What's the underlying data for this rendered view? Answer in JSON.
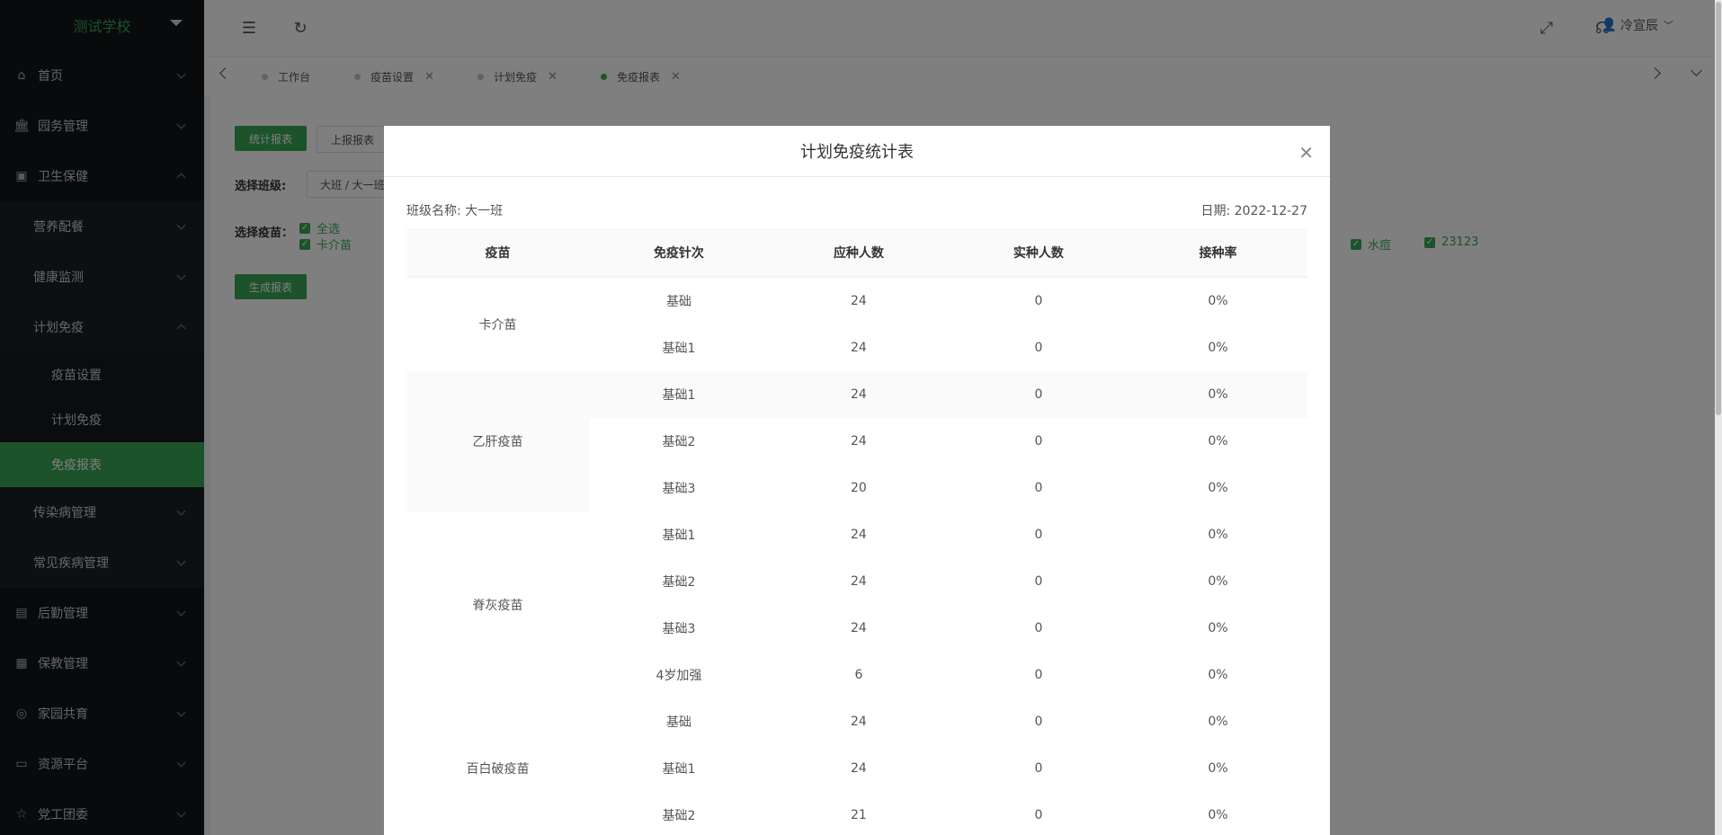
{
  "sidebar": {
    "school": "测试学校",
    "menu": {
      "home": "首页",
      "affairs": "园务管理",
      "health": "卫生保健",
      "nutrition": "营养配餐",
      "monitor": "健康监测",
      "immunization": "计划免疫",
      "vaccine_settings": "疫苗设置",
      "plan_immunization": "计划免疫",
      "immunization_report": "免疫报表",
      "infectious": "传染病管理",
      "common_disease": "常见疾病管理",
      "logistics": "后勤管理",
      "care": "保教管理",
      "home_school": "家园共育",
      "resources": "资源平台",
      "party": "党工团委"
    }
  },
  "topbar": {
    "user": "冷宣辰"
  },
  "tabs": [
    {
      "label": "工作台"
    },
    {
      "label": "疫苗设置"
    },
    {
      "label": "计划免疫"
    },
    {
      "label": "免疫报表"
    }
  ],
  "page": {
    "stat_report": "统计报表",
    "upload_report": "上报报表",
    "select_class_label": "选择班级:",
    "class_value": "大班 / 大一班",
    "select_vaccine_label": "选择疫苗：",
    "check_all": "全选",
    "vaccines_visible": [
      "卡介苗",
      "水痘",
      "23123"
    ],
    "generate": "生成报表"
  },
  "modal": {
    "title": "计划免疫统计表",
    "class_name_label": "班级名称:",
    "class_name": "大一班",
    "date_label": "日期:",
    "date": "2022-12-27",
    "headers": [
      "疫苗",
      "免疫针次",
      "应种人数",
      "实种人数",
      "接种率"
    ],
    "groups": [
      {
        "vaccine": "卡介苗",
        "rows": [
          [
            "基础",
            "24",
            "0",
            "0%"
          ],
          [
            "基础1",
            "24",
            "0",
            "0%"
          ]
        ]
      },
      {
        "vaccine": "乙肝疫苗",
        "rows": [
          [
            "基础1",
            "24",
            "0",
            "0%"
          ],
          [
            "基础2",
            "24",
            "0",
            "0%"
          ],
          [
            "基础3",
            "20",
            "0",
            "0%"
          ]
        ]
      },
      {
        "vaccine": "脊灰疫苗",
        "rows": [
          [
            "基础1",
            "24",
            "0",
            "0%"
          ],
          [
            "基础2",
            "24",
            "0",
            "0%"
          ],
          [
            "基础3",
            "24",
            "0",
            "0%"
          ],
          [
            "4岁加强",
            "6",
            "0",
            "0%"
          ]
        ]
      },
      {
        "vaccine": "百白破疫苗",
        "rows": [
          [
            "基础",
            "24",
            "0",
            "0%"
          ],
          [
            "基础1",
            "24",
            "0",
            "0%"
          ],
          [
            "基础2",
            "21",
            "0",
            "0%"
          ]
        ]
      }
    ]
  }
}
